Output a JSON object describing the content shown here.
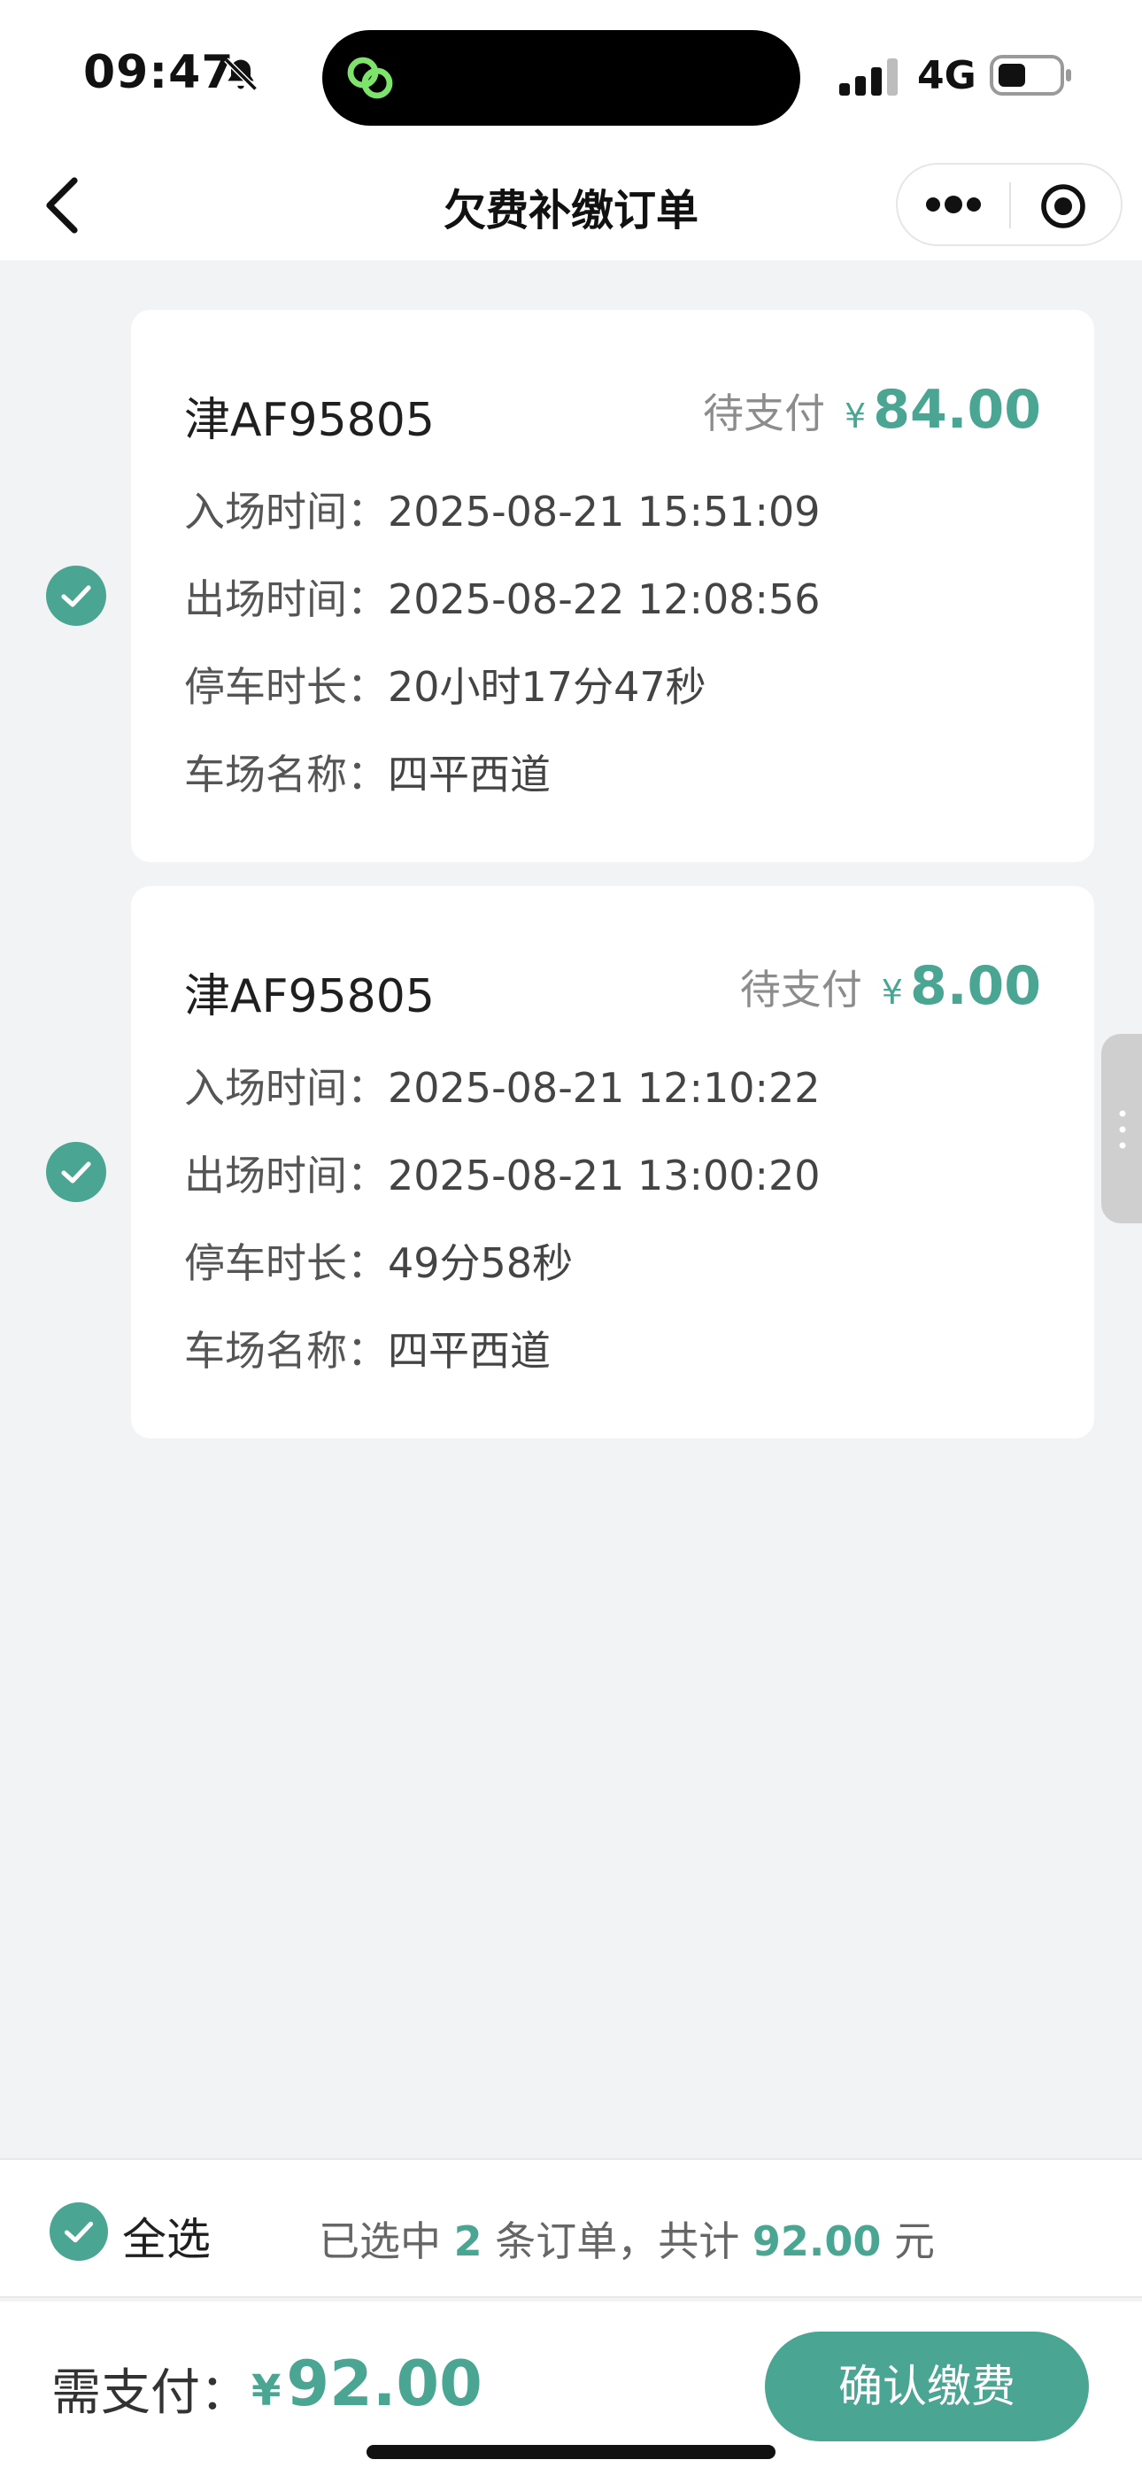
{
  "status_bar": {
    "time": "09:47",
    "network": "4G",
    "icons": [
      "bell-slash-icon",
      "chat-link-icon",
      "signal-icon",
      "battery-icon"
    ]
  },
  "nav": {
    "title": "欠费补缴订单",
    "icons": [
      "back-chevron-icon",
      "more-dots-icon",
      "close-circle-icon"
    ]
  },
  "orders": [
    {
      "plate": "津AF95805",
      "status": "待支付",
      "currency": "¥",
      "amount": "84.00",
      "checked": true,
      "rows": [
        {
          "label": "入场时间：",
          "value": "2025-08-21 15:51:09"
        },
        {
          "label": "出场时间：",
          "value": "2025-08-22 12:08:56"
        },
        {
          "label": "停车时长：",
          "value": "20小时17分47秒"
        },
        {
          "label": "车场名称：",
          "value": "四平西道"
        }
      ]
    },
    {
      "plate": "津AF95805",
      "status": "待支付",
      "currency": "¥",
      "amount": "8.00",
      "checked": true,
      "rows": [
        {
          "label": "入场时间：",
          "value": "2025-08-21 12:10:22"
        },
        {
          "label": "出场时间：",
          "value": "2025-08-21 13:00:20"
        },
        {
          "label": "停车时长：",
          "value": "49分58秒"
        },
        {
          "label": "车场名称：",
          "value": "四平西道"
        }
      ]
    }
  ],
  "selection": {
    "select_all_label": "全选",
    "summary_prefix": "已选中 ",
    "count": "2",
    "summary_middle": " 条订单，共计 ",
    "total": "92.00",
    "summary_suffix": " 元"
  },
  "payment": {
    "label": "需支付：",
    "currency": "¥",
    "amount": "92.00",
    "confirm_label": "确认缴费"
  },
  "colors": {
    "accent": "#4aa592",
    "background": "#f2f3f5",
    "card": "#ffffff",
    "muted_text": "#8c8c8c"
  }
}
